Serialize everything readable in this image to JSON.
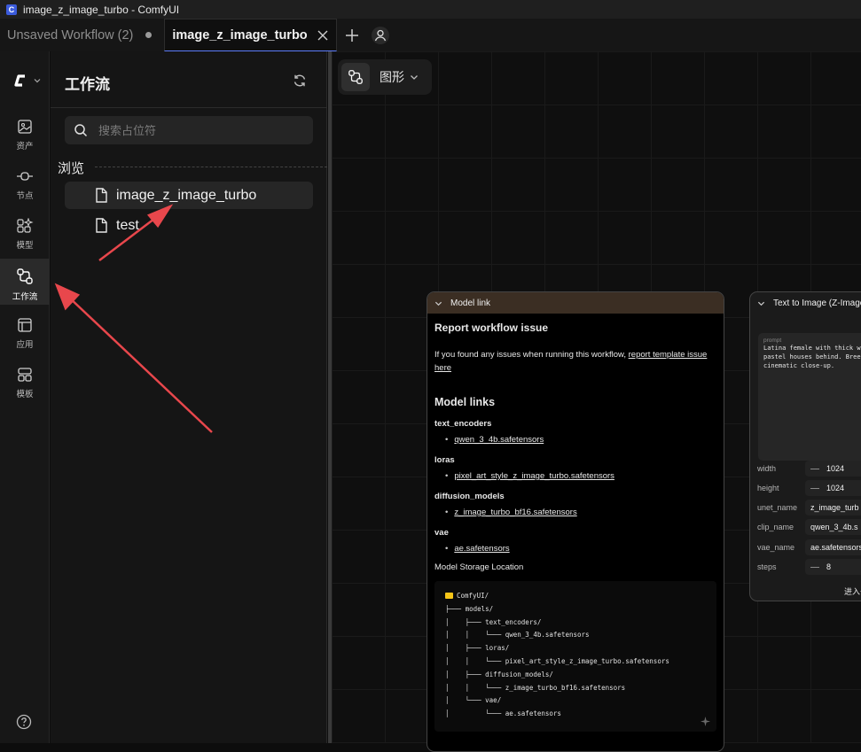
{
  "window": {
    "title": "image_z_image_turbo - ComfyUI"
  },
  "tabs": [
    {
      "label": "Unsaved Workflow (2)"
    },
    {
      "label": "image_z_image_turbo"
    }
  ],
  "rail": {
    "items": [
      {
        "label": "资产",
        "icon": "image-icon"
      },
      {
        "label": "节点",
        "icon": "node-icon"
      },
      {
        "label": "模型",
        "icon": "model-icon"
      },
      {
        "label": "工作流",
        "icon": "workflow-icon"
      },
      {
        "label": "应用",
        "icon": "app-icon"
      },
      {
        "label": "模板",
        "icon": "template-icon"
      }
    ]
  },
  "panel": {
    "title": "工作流",
    "search_placeholder": "搜索占位符",
    "browse_label": "浏览",
    "files": [
      {
        "name": "image_z_image_turbo"
      },
      {
        "name": "test"
      }
    ]
  },
  "canvas": {
    "view_label": "图形"
  },
  "model_link_node": {
    "title": "Model link",
    "heading1": "Report workflow issue",
    "intro_text": "If you found any issues when running this workflow, ",
    "intro_link": "report template issue here",
    "heading2": "Model links",
    "categories": [
      {
        "name": "text_encoders",
        "file": "qwen_3_4b.safetensors"
      },
      {
        "name": "loras",
        "file": "pixel_art_style_z_image_turbo.safetensors"
      },
      {
        "name": "diffusion_models",
        "file": "z_image_turbo_bf16.safetensors"
      },
      {
        "name": "vae",
        "file": "ae.safetensors"
      }
    ],
    "storage_label": "Model Storage Location",
    "tree": [
      "ComfyUI/",
      "├─── models/",
      "│    ├─── text_encoders/",
      "│    │    └─── qwen_3_4b.safetensors",
      "│    ├─── loras/",
      "│    │    └─── pixel_art_style_z_image_turbo.safetensors",
      "│    ├─── diffusion_models/",
      "│    │    └─── z_image_turbo_bf16.safetensors",
      "│    └─── vae/",
      "│         └─── ae.safetensors"
    ]
  },
  "text_to_image_node": {
    "title": "Text to Image (Z-Image",
    "prompt_label": "prompt",
    "prompt_lines": [
      "Latina female with thick wav",
      "pastel houses behind. Breezy",
      "cinematic close-up."
    ],
    "widgets": [
      {
        "label": "width",
        "value": "1024"
      },
      {
        "label": "height",
        "value": "1024"
      },
      {
        "label": "unet_name",
        "value": "z_image_turb"
      },
      {
        "label": "clip_name",
        "value": "qwen_3_4b.s"
      },
      {
        "label": "vae_name",
        "value": "ae.safetensors"
      },
      {
        "label": "steps",
        "value": "8"
      }
    ],
    "enter_label": "进入子"
  },
  "colors": {
    "accent": "#5c7cfa",
    "arrow": "#e8474c",
    "node_header": "#3b2e23",
    "folder": "#f5c518"
  }
}
